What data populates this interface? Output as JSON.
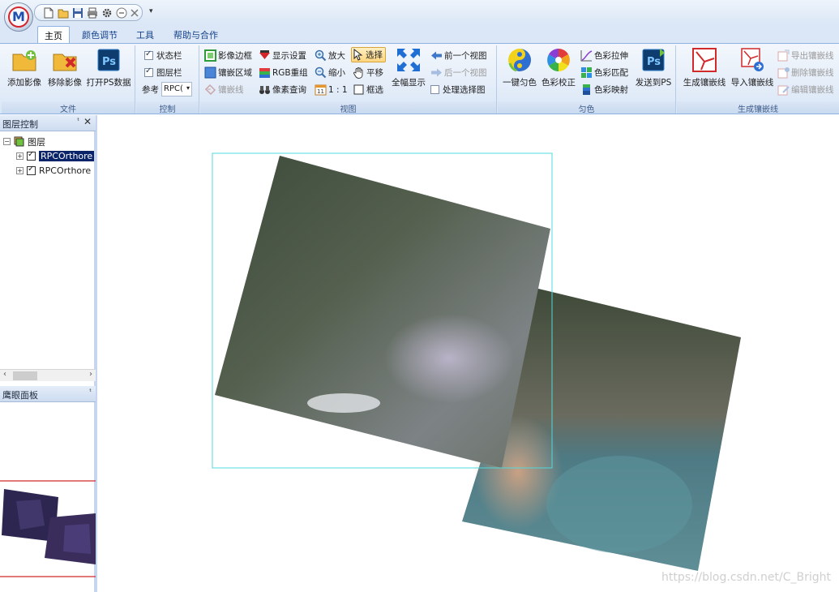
{
  "app": {
    "logo_letter": "M"
  },
  "tabs": [
    {
      "label": "主页",
      "active": true
    },
    {
      "label": "颜色调节",
      "active": false
    },
    {
      "label": "工具",
      "active": false
    },
    {
      "label": "帮助与合作",
      "active": false
    }
  ],
  "ribbon": {
    "file": {
      "label": "文件",
      "add_image": "添加影像",
      "remove_image": "移除影像",
      "open_ps": "打开PS数据"
    },
    "control": {
      "label": "控制",
      "status_bar": "状态栏",
      "layer_bar": "图层栏",
      "reference_label": "参考",
      "reference_value": "RPC("
    },
    "view": {
      "label": "视图",
      "image_border": "影像边框",
      "display_settings": "显示设置",
      "zoom_in": "放大",
      "select": "选择",
      "mosaic_area": "镶嵌区域",
      "rgb_recombine": "RGB重组",
      "zoom_out": "缩小",
      "pan": "平移",
      "mosaic_line": "镶嵌线",
      "pixel_query": "像素查询",
      "one_to_one": "1 : 1",
      "box_select": "框选",
      "full_extent": "全幅显示",
      "prev_view": "前一个视图",
      "next_view": "后一个视图",
      "process_selection": "处理选择图"
    },
    "dodging": {
      "label": "匀色",
      "one_click": "一键匀色",
      "color_correct": "色彩校正",
      "color_stretch": "色彩拉伸",
      "color_match": "色彩匹配",
      "color_map": "色彩映射",
      "send_ps": "发送到PS"
    },
    "seamline": {
      "label": "生成镶嵌线",
      "generate": "生成镶嵌线",
      "import": "导入镶嵌线",
      "export": "导出镶嵌线",
      "delete": "删除镶嵌线",
      "edit": "编辑镶嵌线"
    }
  },
  "layer_panel": {
    "title": "图层控制",
    "root": "图层",
    "layers": [
      {
        "name": "RPCOrthore",
        "selected": true
      },
      {
        "name": "RPCOrthore",
        "selected": false
      }
    ]
  },
  "eagle_panel": {
    "title": "鹰眼面板"
  },
  "canvas": {
    "watermark": "https://blog.csdn.net/C_Bright"
  },
  "colors": {
    "accent": "#15428b",
    "selection_box": "#4fd8dc",
    "eagle_line": "#d22b2b"
  }
}
